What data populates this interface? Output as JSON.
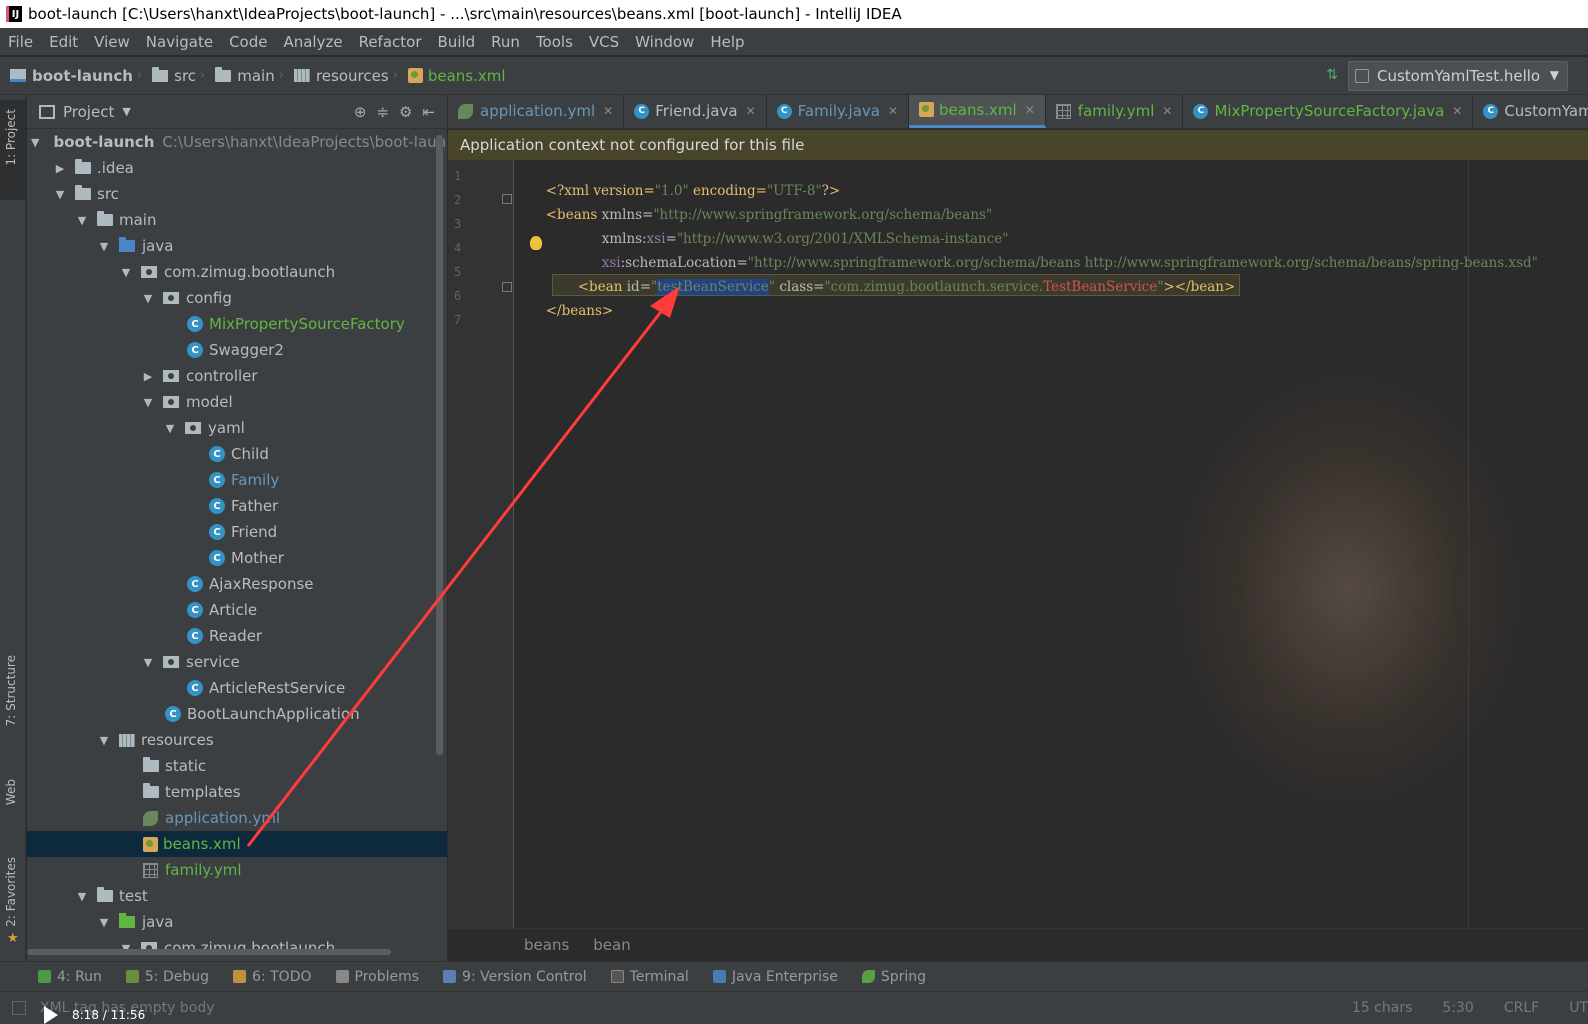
{
  "window": {
    "title": "boot-launch [C:\\Users\\hanxt\\IdeaProjects\\boot-launch] - ...\\src\\main\\resources\\beans.xml [boot-launch] - IntelliJ IDEA"
  },
  "menu": [
    "File",
    "Edit",
    "View",
    "Navigate",
    "Code",
    "Analyze",
    "Refactor",
    "Build",
    "Run",
    "Tools",
    "VCS",
    "Window",
    "Help"
  ],
  "breadcrumb": [
    "boot-launch",
    "src",
    "main",
    "resources",
    "beans.xml"
  ],
  "run_config": "CustomYamlTest.hello",
  "side_tabs": {
    "project": "1: Project",
    "structure": "7: Structure",
    "web": "Web",
    "favorites": "2: Favorites"
  },
  "project_panel": {
    "title": "Project",
    "root_name": "boot-launch",
    "root_path": "C:\\Users\\hanxt\\IdeaProjects\\boot-launch",
    "tree": [
      {
        "label": ".idea"
      },
      {
        "label": "src"
      },
      {
        "label": "main"
      },
      {
        "label": "java"
      },
      {
        "label": "com.zimug.bootlaunch"
      },
      {
        "label": "config"
      },
      {
        "label": "MixPropertySourceFactory"
      },
      {
        "label": "Swagger2"
      },
      {
        "label": "controller"
      },
      {
        "label": "model"
      },
      {
        "label": "yaml"
      },
      {
        "label": "Child"
      },
      {
        "label": "Family"
      },
      {
        "label": "Father"
      },
      {
        "label": "Friend"
      },
      {
        "label": "Mother"
      },
      {
        "label": "AjaxResponse"
      },
      {
        "label": "Article"
      },
      {
        "label": "Reader"
      },
      {
        "label": "service"
      },
      {
        "label": "ArticleRestService"
      },
      {
        "label": "BootLaunchApplication"
      },
      {
        "label": "resources"
      },
      {
        "label": "static"
      },
      {
        "label": "templates"
      },
      {
        "label": "application.yml"
      },
      {
        "label": "beans.xml"
      },
      {
        "label": "family.yml"
      },
      {
        "label": "test"
      },
      {
        "label": "java"
      },
      {
        "label": "com.zimug.bootlaunch"
      }
    ]
  },
  "editor": {
    "tabs": [
      "application.yml",
      "Friend.java",
      "Family.java",
      "beans.xml",
      "family.yml",
      "MixPropertySourceFactory.java",
      "CustomYam"
    ],
    "active_tab": "beans.xml",
    "banner": "Application context not configured for this file",
    "line_numbers": [
      "1",
      "2",
      "3",
      "4",
      "5",
      "6",
      "7"
    ],
    "code": {
      "l1_a": "<?xml version=",
      "l1_b": "\"1.0\"",
      "l1_c": " encoding=",
      "l1_d": "\"UTF-8\"",
      "l1_e": "?>",
      "l2_tag": "<beans ",
      "l2_attr": "xmlns=",
      "l2_val": "\"http://www.springframework.org/schema/beans\"",
      "l3_attr": "xmlns:",
      "l3_ns": "xsi",
      "l3_eq": "=",
      "l3_val": "\"http://www.w3.org/2001/XMLSchema-instance\"",
      "l4_ns": "xsi",
      "l4_attr": ":schemaLocation=",
      "l4_val": "\"http://www.springframework.org/schema/beans http://www.springframework.org/schema/beans/spring-beans.xsd\"",
      "l5_tag": "<bean ",
      "l5_attr1": "id=",
      "l5_q1": "\"",
      "l5_id": "testBeanService",
      "l5_q2": "\"",
      "l5_attr2": " class=",
      "l5_pkg": "\"com.zimug.bootlaunch.service.",
      "l5_cls": "TestBeanService",
      "l5_q3": "\"",
      "l5_close": "></bean>",
      "l6_tag": "</beans>"
    },
    "breadcrumb": [
      "beans",
      "bean"
    ]
  },
  "bottom_tools": [
    "4: Run",
    "5: Debug",
    "6: TODO",
    "Problems",
    "9: Version Control",
    "Terminal",
    "Java Enterprise",
    "Spring"
  ],
  "status": {
    "message": "XML tag has empty body",
    "chars": "15 chars",
    "position": "5:30",
    "line_ending": "CRLF",
    "encoding": "UT"
  },
  "video": {
    "time": "8:18 / 11:56"
  },
  "colors": {
    "selection": "#0d293e",
    "arrow": "#ff3b3b",
    "banner": "#49452b"
  }
}
